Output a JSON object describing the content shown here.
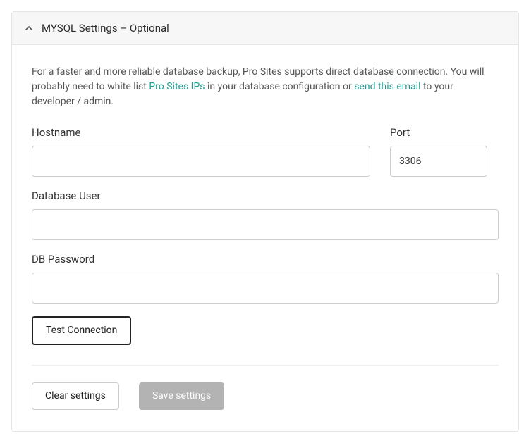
{
  "panel": {
    "title": "MYSQL Settings – Optional"
  },
  "description": {
    "part1": "For a faster and more reliable database backup, Pro Sites supports direct database connection. You will probably need to white list ",
    "link1": "Pro Sites IPs",
    "part2": " in your database configuration or ",
    "link2": "send this email",
    "part3": " to your developer / admin."
  },
  "fields": {
    "hostname": {
      "label": "Hostname",
      "value": ""
    },
    "port": {
      "label": "Port",
      "value": "3306"
    },
    "dbuser": {
      "label": "Database User",
      "value": ""
    },
    "dbpassword": {
      "label": "DB Password",
      "value": ""
    }
  },
  "buttons": {
    "test": "Test Connection",
    "clear": "Clear settings",
    "save": "Save settings"
  }
}
